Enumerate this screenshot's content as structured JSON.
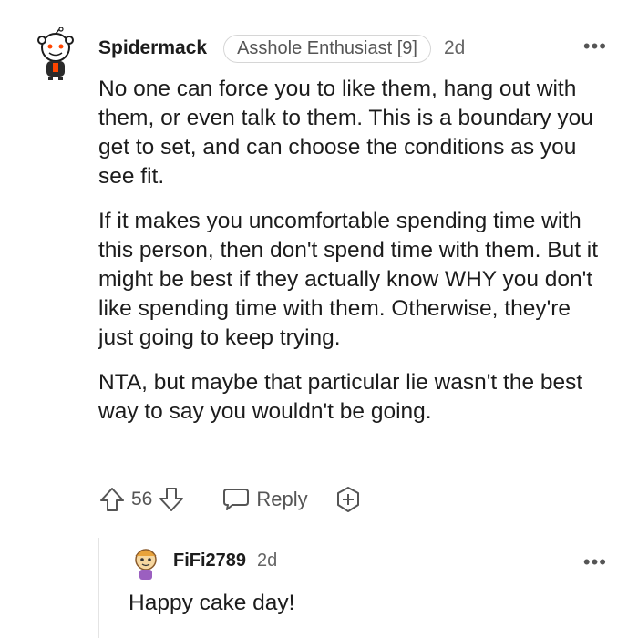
{
  "comment": {
    "username": "Spidermack",
    "flair": "Asshole Enthusiast [9]",
    "age": "2d",
    "more": "•••",
    "paragraphs": [
      "No one can force you to like them, hang out with them, or even talk to them. This is a boundary you get to set, and can choose the conditions as you see fit.",
      "If it makes you uncomfortable spending time with this person, then don't spend time with them. But it might be best if they actually know WHY you don't like spending time with them. Otherwise, they're just going to keep trying.",
      "NTA, but maybe that particular lie wasn't the best way to say you wouldn't be going."
    ],
    "score": "56",
    "reply_label": "Reply",
    "icons": [
      "upvote-icon",
      "downvote-icon",
      "chat-bubble-icon",
      "award-plus-icon",
      "more-icon"
    ]
  },
  "reply": {
    "username": "FiFi2789",
    "age": "2d",
    "more": "•••",
    "text": "Happy cake day!"
  },
  "colors": {
    "text": "#1c1c1c",
    "meta": "#666666",
    "border": "#d6d6d6",
    "thread_line": "#e4e4e4"
  }
}
